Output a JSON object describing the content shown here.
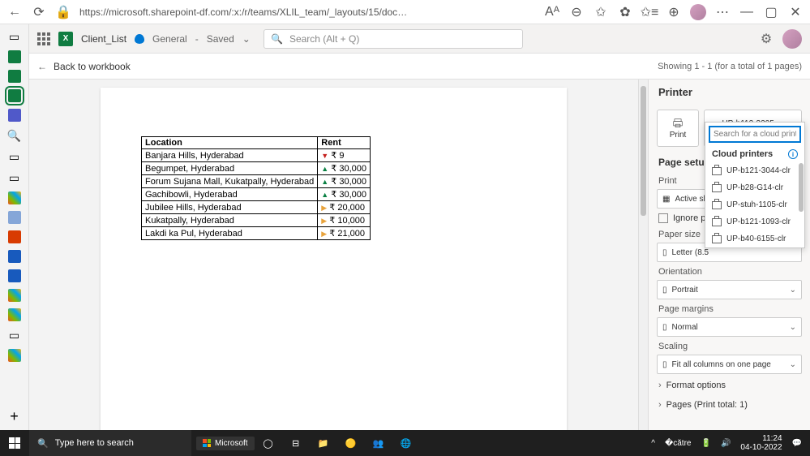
{
  "browser": {
    "url": "https://microsoft.sharepoint-df.com/:x:/r/teams/XLIL_team/_layouts/15/doc2.aspx?sourcedoc=%..."
  },
  "app": {
    "doc_name": "Client_List",
    "sensitivity": "General",
    "saved_state": "Saved",
    "search_placeholder": "Search (Alt + Q)"
  },
  "sub": {
    "back_label": "Back to workbook",
    "showing": "Showing 1 - 1 (for a total of 1 pages)"
  },
  "table": {
    "headers": [
      "Location",
      "Rent"
    ],
    "rows": [
      {
        "loc": "Banjara Hills, Hyderabad",
        "dir": "dn",
        "rent": "₹ 9"
      },
      {
        "loc": "Begumpet, Hyderabad",
        "dir": "up",
        "rent": "₹ 30,000"
      },
      {
        "loc": "Forum Sujana Mall, Kukatpally, Hyderabad",
        "dir": "up",
        "rent": "₹ 30,000"
      },
      {
        "loc": "Gachibowli, Hyderabad",
        "dir": "up",
        "rent": "₹ 30,000"
      },
      {
        "loc": "Jubilee Hills, Hyderabad",
        "dir": "yl",
        "rent": "₹ 20,000"
      },
      {
        "loc": "Kukatpally, Hyderabad",
        "dir": "yl",
        "rent": "₹ 10,000"
      },
      {
        "loc": "Lakdi ka Pul, Hyderabad",
        "dir": "yl",
        "rent": "₹ 21,000"
      }
    ]
  },
  "printer": {
    "title": "Printer",
    "print_btn": "Print",
    "selected_printer": "UP-b112-3205-clr2"
  },
  "popup": {
    "placeholder": "Search for a cloud printer",
    "section": "Cloud printers",
    "items": [
      "UP-b121-3044-clr",
      "UP-b28-G14-clr",
      "UP-stuh-1105-clr",
      "UP-b121-1093-clr",
      "UP-b40-6155-clr"
    ]
  },
  "setup": {
    "title": "Page setup",
    "print_label": "Print",
    "print_value": "Active she",
    "ignore": "Ignore pr",
    "paper_label": "Paper size",
    "paper_value": "Letter (8.5",
    "orient_label": "Orientation",
    "orient_value": "Portrait",
    "margins_label": "Page margins",
    "margins_value": "Normal",
    "scaling_label": "Scaling",
    "scaling_value": "Fit all columns on one page",
    "format": "Format options",
    "pages": "Pages (Print total: 1)"
  },
  "taskbar": {
    "search_placeholder": "Type here to search",
    "ms": "Microsoft",
    "time": "11:24",
    "date": "04-10-2022"
  }
}
